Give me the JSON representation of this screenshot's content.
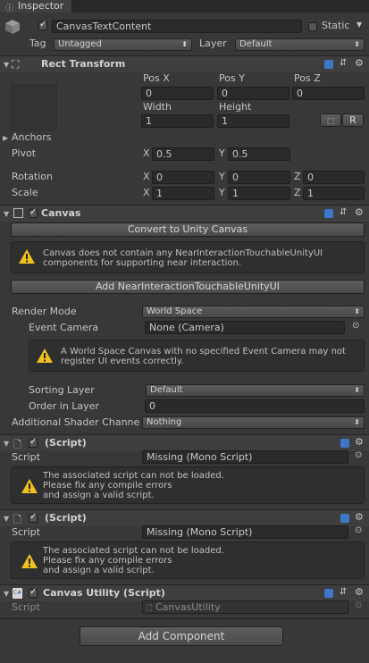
{
  "tab": {
    "title": "Inspector"
  },
  "object": {
    "name": "CanvasTextContent",
    "static_label": "Static",
    "tag_label": "Tag",
    "tag_value": "Untagged",
    "layer_label": "Layer",
    "layer_value": "Default"
  },
  "rect_transform": {
    "title": "Rect Transform",
    "pos_x_label": "Pos X",
    "pos_y_label": "Pos Y",
    "pos_z_label": "Pos Z",
    "pos_x": "0",
    "pos_y": "0",
    "pos_z": "0",
    "width_label": "Width",
    "height_label": "Height",
    "width": "1",
    "height": "1",
    "raw_button": "R",
    "anchors_label": "Anchors",
    "pivot_label": "Pivot",
    "pivot_x": "0.5",
    "pivot_y": "0.5",
    "rotation_label": "Rotation",
    "rot_x": "0",
    "rot_y": "0",
    "rot_z": "0",
    "scale_label": "Scale",
    "scale_x": "1",
    "scale_y": "1",
    "scale_z": "1",
    "x": "X",
    "y": "Y",
    "z": "Z"
  },
  "canvas": {
    "title": "Canvas",
    "convert_button": "Convert to Unity Canvas",
    "warning": "Canvas does not contain any NearInteractionTouchableUnityUI\ncomponents for supporting near interaction.",
    "add_touchable_button": "Add NearInteractionTouchableUnityUI",
    "render_mode_label": "Render Mode",
    "render_mode_value": "World Space",
    "event_camera_label": "Event Camera",
    "event_camera_value": "None (Camera)",
    "camera_warning": "A World Space Canvas with no specified Event Camera may not\nregister UI events correctly.",
    "sorting_layer_label": "Sorting Layer",
    "sorting_layer_value": "Default",
    "order_label": "Order in Layer",
    "order_value": "0",
    "shader_label": "Additional Shader Channe",
    "shader_value": "Nothing"
  },
  "missing_script_1": {
    "title": "(Script)",
    "script_label": "Script",
    "script_value": "Missing (Mono Script)",
    "warning": "The associated script can not be loaded.\nPlease fix any compile errors\nand assign a valid script."
  },
  "missing_script_2": {
    "title": "(Script)",
    "script_label": "Script",
    "script_value": "Missing (Mono Script)",
    "warning": "The associated script can not be loaded.\nPlease fix any compile errors\nand assign a valid script."
  },
  "canvas_utility": {
    "title": "Canvas Utility (Script)",
    "script_label": "Script",
    "script_value": "CanvasUtility"
  },
  "add_component_button": "Add Component",
  "colors": {
    "background": "#383838",
    "field": "#2a2a2a",
    "warning": "#f0c020",
    "help_icon": "#3d78c8"
  }
}
